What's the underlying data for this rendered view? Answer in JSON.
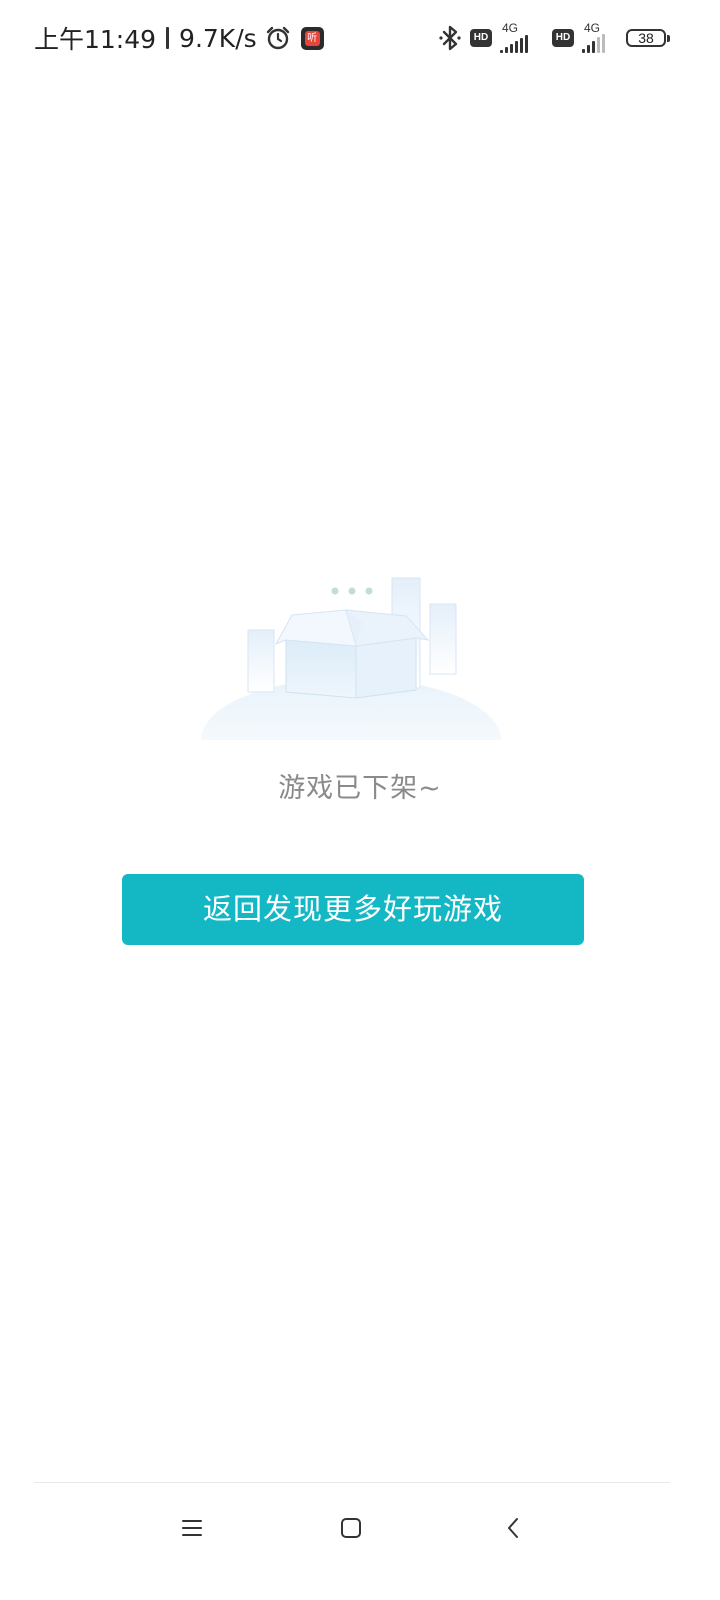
{
  "status_bar": {
    "time": "上午11:49",
    "net_speed": "9.7K/s",
    "app_badge_char": "听",
    "icons": [
      "alarm-icon",
      "app-notification-icon",
      "bluetooth-icon",
      "hd-icon",
      "signal-icon",
      "hd-icon",
      "signal-icon",
      "battery-icon"
    ],
    "hd_label": "HD",
    "network_type_1": "4G",
    "network_type_2": "4G",
    "battery_level": "38"
  },
  "empty_state": {
    "icon": "empty-box-illustration",
    "message": "游戏已下架~"
  },
  "action": {
    "button_label": "返回发现更多好玩游戏",
    "button_color": "#14b8c5"
  },
  "nav_bar": {
    "icons": [
      "menu-icon",
      "home-icon",
      "back-icon"
    ]
  }
}
